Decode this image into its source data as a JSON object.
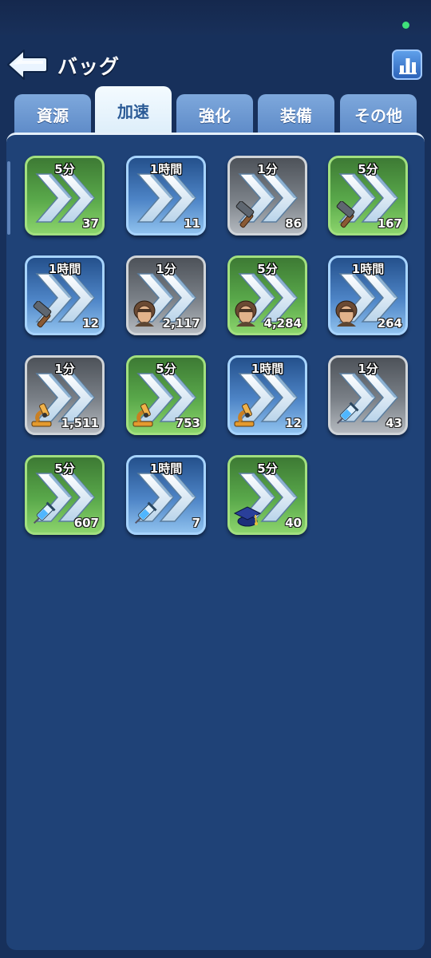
{
  "header": {
    "title": "バッグ"
  },
  "tabs": [
    {
      "label": "資源"
    },
    {
      "label": "加速"
    },
    {
      "label": "強化"
    },
    {
      "label": "装備"
    },
    {
      "label": "その他"
    }
  ],
  "active_tab": "加速",
  "items": [
    {
      "duration": "5分",
      "count": "37",
      "tier": "green",
      "type": "general"
    },
    {
      "duration": "1時間",
      "count": "11",
      "tier": "blue",
      "type": "general"
    },
    {
      "duration": "1分",
      "count": "86",
      "tier": "gray",
      "type": "hammer"
    },
    {
      "duration": "5分",
      "count": "167",
      "tier": "green",
      "type": "hammer"
    },
    {
      "duration": "1時間",
      "count": "12",
      "tier": "blue",
      "type": "hammer"
    },
    {
      "duration": "1分",
      "count": "2,117",
      "tier": "gray",
      "type": "soldier"
    },
    {
      "duration": "5分",
      "count": "4,284",
      "tier": "green",
      "type": "soldier"
    },
    {
      "duration": "1時間",
      "count": "264",
      "tier": "blue",
      "type": "soldier"
    },
    {
      "duration": "1分",
      "count": "1,511",
      "tier": "gray",
      "type": "microscope"
    },
    {
      "duration": "5分",
      "count": "753",
      "tier": "green",
      "type": "microscope"
    },
    {
      "duration": "1時間",
      "count": "12",
      "tier": "blue",
      "type": "microscope"
    },
    {
      "duration": "1分",
      "count": "43",
      "tier": "gray",
      "type": "syringe"
    },
    {
      "duration": "5分",
      "count": "607",
      "tier": "green",
      "type": "syringe"
    },
    {
      "duration": "1時間",
      "count": "7",
      "tier": "blue",
      "type": "syringe"
    },
    {
      "duration": "5分",
      "count": "40",
      "tier": "green",
      "type": "graduation-cap"
    }
  ],
  "colors": {
    "background": "#17305b",
    "panel": "#1f4277",
    "tier_green": "#59a84a",
    "tier_blue": "#4d84c6",
    "tier_gray": "#7a8087",
    "status_dot": "#3fe07a"
  }
}
